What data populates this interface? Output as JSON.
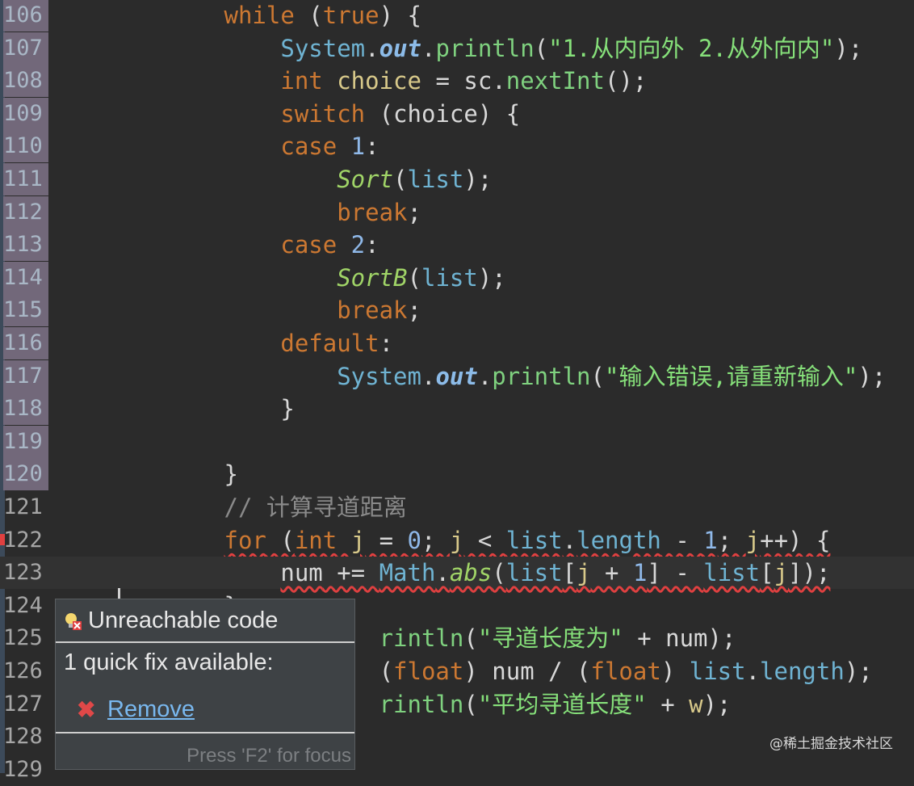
{
  "lines": [
    {
      "no": "106",
      "tokens": [
        [
          "            ",
          ""
        ],
        [
          "while",
          "kw"
        ],
        [
          " (",
          "p"
        ],
        [
          "true",
          "kw"
        ],
        [
          ") {",
          "p"
        ]
      ]
    },
    {
      "no": "107",
      "tokens": [
        [
          "                ",
          ""
        ],
        [
          "System",
          "cls"
        ],
        [
          ".",
          "p"
        ],
        [
          "out",
          "fld"
        ],
        [
          ".",
          "p"
        ],
        [
          "println",
          "meth"
        ],
        [
          "(",
          "p"
        ],
        [
          "\"1.从内向外 2.从外向内\"",
          "str"
        ],
        [
          ");",
          "p"
        ]
      ]
    },
    {
      "no": "108",
      "tokens": [
        [
          "                ",
          ""
        ],
        [
          "int",
          "kw"
        ],
        [
          " ",
          "p"
        ],
        [
          "choice",
          "var"
        ],
        [
          " = sc.",
          "p"
        ],
        [
          "nextInt",
          "meth"
        ],
        [
          "();",
          "p"
        ]
      ]
    },
    {
      "no": "109",
      "tokens": [
        [
          "                ",
          ""
        ],
        [
          "switch",
          "kw"
        ],
        [
          " (choice) {",
          "p"
        ]
      ]
    },
    {
      "no": "110",
      "tokens": [
        [
          "                ",
          ""
        ],
        [
          "case",
          "kw"
        ],
        [
          " ",
          "p"
        ],
        [
          "1",
          "num"
        ],
        [
          ":",
          "p"
        ]
      ]
    },
    {
      "no": "111",
      "tokens": [
        [
          "                    ",
          ""
        ],
        [
          "Sort",
          "smeth"
        ],
        [
          "(",
          "p"
        ],
        [
          "list",
          "cls"
        ],
        [
          ");",
          "p"
        ]
      ]
    },
    {
      "no": "112",
      "tokens": [
        [
          "                    ",
          ""
        ],
        [
          "break",
          "kw"
        ],
        [
          ";",
          "p"
        ]
      ]
    },
    {
      "no": "113",
      "tokens": [
        [
          "                ",
          ""
        ],
        [
          "case",
          "kw"
        ],
        [
          " ",
          "p"
        ],
        [
          "2",
          "num"
        ],
        [
          ":",
          "p"
        ]
      ]
    },
    {
      "no": "114",
      "tokens": [
        [
          "                    ",
          ""
        ],
        [
          "SortB",
          "smeth"
        ],
        [
          "(",
          "p"
        ],
        [
          "list",
          "cls"
        ],
        [
          ");",
          "p"
        ]
      ]
    },
    {
      "no": "115",
      "tokens": [
        [
          "                    ",
          ""
        ],
        [
          "break",
          "kw"
        ],
        [
          ";",
          "p"
        ]
      ]
    },
    {
      "no": "116",
      "tokens": [
        [
          "                ",
          ""
        ],
        [
          "default",
          "kw"
        ],
        [
          ":",
          "p"
        ]
      ]
    },
    {
      "no": "117",
      "tokens": [
        [
          "                    ",
          ""
        ],
        [
          "System",
          "cls"
        ],
        [
          ".",
          "p"
        ],
        [
          "out",
          "fld"
        ],
        [
          ".",
          "p"
        ],
        [
          "println",
          "meth"
        ],
        [
          "(",
          "p"
        ],
        [
          "\"输入错误,请重新输入\"",
          "str"
        ],
        [
          ");",
          "p"
        ]
      ]
    },
    {
      "no": "118",
      "tokens": [
        [
          "                ",
          ""
        ],
        [
          "}",
          "p"
        ]
      ]
    },
    {
      "no": "119",
      "tokens": []
    },
    {
      "no": "120",
      "tokens": [
        [
          "            ",
          ""
        ],
        [
          "}",
          "p"
        ]
      ]
    },
    {
      "no": "121",
      "tokens": [
        [
          "            ",
          ""
        ],
        [
          "// 计算寻道距离",
          "cmt"
        ]
      ]
    },
    {
      "no": "122",
      "tokens": [
        [
          "            ",
          ""
        ],
        [
          "for",
          "kw err"
        ],
        [
          " (",
          "p err"
        ],
        [
          "int",
          "kw err"
        ],
        [
          " ",
          "p err"
        ],
        [
          "j",
          "var err"
        ],
        [
          " = ",
          "p err"
        ],
        [
          "0",
          "num err"
        ],
        [
          "; ",
          "p err"
        ],
        [
          "j",
          "var err"
        ],
        [
          " < ",
          "p err"
        ],
        [
          "list",
          "cls err"
        ],
        [
          ".",
          "p err"
        ],
        [
          "length",
          "cls err"
        ],
        [
          " - ",
          "p err"
        ],
        [
          "1",
          "num err"
        ],
        [
          "; ",
          "p err"
        ],
        [
          "j",
          "var err"
        ],
        [
          "++) {",
          "p err"
        ]
      ]
    },
    {
      "no": "123",
      "tokens": [
        [
          "                ",
          ""
        ],
        [
          "num",
          "p err"
        ],
        [
          " += ",
          "p err"
        ],
        [
          "Math",
          "cls err"
        ],
        [
          ".",
          "p err"
        ],
        [
          "abs",
          "smeth err"
        ],
        [
          "(",
          "p err"
        ],
        [
          "list",
          "cls err"
        ],
        [
          "[",
          "p err"
        ],
        [
          "j",
          "var err"
        ],
        [
          " + ",
          "p err"
        ],
        [
          "1",
          "num err"
        ],
        [
          "] - ",
          "p err"
        ],
        [
          "list",
          "cls err"
        ],
        [
          "[",
          "p err"
        ],
        [
          "j",
          "var err"
        ],
        [
          "]);",
          "p err"
        ]
      ]
    },
    {
      "no": "124",
      "tokens": [
        [
          "            ",
          ""
        ],
        [
          "}",
          "p"
        ]
      ]
    },
    {
      "no": "125",
      "tokens": [
        [
          "                       ",
          ""
        ],
        [
          "rintln",
          "meth"
        ],
        [
          "(",
          "p"
        ],
        [
          "\"寻道长度为\"",
          "str"
        ],
        [
          " + num);",
          "p"
        ]
      ]
    },
    {
      "no": "126",
      "tokens": [
        [
          "                       ",
          ""
        ],
        [
          "(",
          "p"
        ],
        [
          "float",
          "kw"
        ],
        [
          ") num / (",
          "p"
        ],
        [
          "float",
          "kw"
        ],
        [
          ") ",
          "p"
        ],
        [
          "list",
          "cls"
        ],
        [
          ".",
          "p"
        ],
        [
          "length",
          "cls"
        ],
        [
          ");",
          "p"
        ]
      ]
    },
    {
      "no": "127",
      "tokens": [
        [
          "                       ",
          ""
        ],
        [
          "rintln",
          "meth"
        ],
        [
          "(",
          "p"
        ],
        [
          "\"平均寻道长度\"",
          "str"
        ],
        [
          " + ",
          "p"
        ],
        [
          "w",
          "var"
        ],
        [
          ");",
          "p"
        ]
      ]
    },
    {
      "no": "128",
      "tokens": []
    },
    {
      "no": "129",
      "tokens": []
    }
  ],
  "popup": {
    "title": "Unreachable code",
    "subtitle": "1 quick fix available:",
    "fix_label": "Remove",
    "footer": "Press 'F2' for focus"
  },
  "watermark": "@稀土掘金技术社区"
}
